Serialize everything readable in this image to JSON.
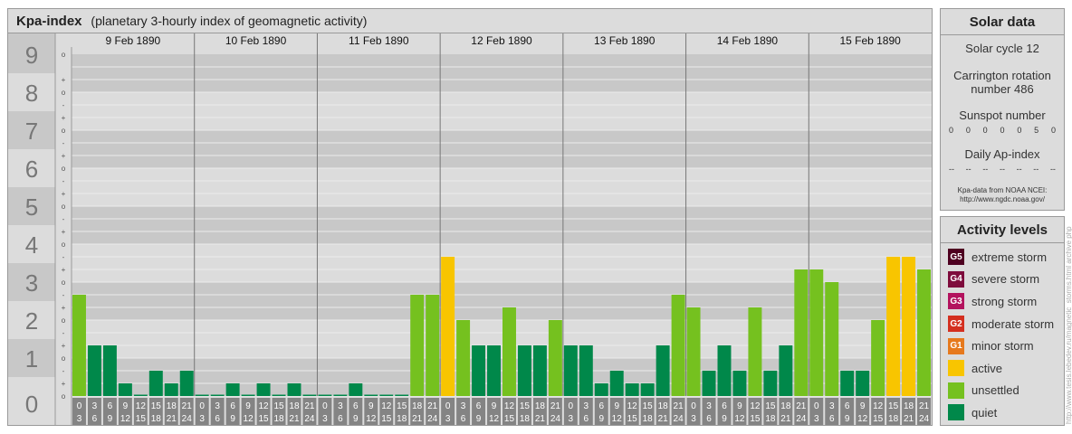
{
  "header": {
    "title": "Kpa-index",
    "subtitle": "(planetary 3-hourly index of geomagnetic activity)"
  },
  "chart_data": {
    "type": "bar",
    "y_range": [
      0,
      9
    ],
    "y_ticks": [
      "0",
      "1",
      "2",
      "3",
      "4",
      "5",
      "6",
      "7",
      "8",
      "9"
    ],
    "y_minor_ticks": [
      "o",
      "+",
      "-"
    ],
    "days": [
      "9 Feb 1890",
      "10 Feb 1890",
      "11 Feb 1890",
      "12 Feb 1890",
      "13 Feb 1890",
      "14 Feb 1890",
      "15 Feb 1890"
    ],
    "intervals": [
      [
        "0",
        "3"
      ],
      [
        "3",
        "6"
      ],
      [
        "6",
        "9"
      ],
      [
        "9",
        "12"
      ],
      [
        "12",
        "15"
      ],
      [
        "15",
        "18"
      ],
      [
        "18",
        "21"
      ],
      [
        "21",
        "24"
      ]
    ],
    "values": [
      2.667,
      1.333,
      1.333,
      0.333,
      0,
      0.667,
      0.333,
      0.667,
      0,
      0,
      0.333,
      0,
      0.333,
      0,
      0.333,
      0,
      0,
      0,
      0.333,
      0,
      0,
      0,
      2.667,
      2.667,
      3.667,
      2.0,
      1.333,
      1.333,
      2.333,
      1.333,
      1.333,
      2.0,
      1.333,
      1.333,
      0.333,
      0.667,
      0.333,
      0.333,
      1.333,
      2.667,
      2.333,
      0.667,
      1.333,
      0.667,
      2.333,
      0.667,
      1.333,
      3.333,
      3.333,
      3.0,
      0.667,
      0.667,
      2.0,
      3.667,
      3.667,
      3.333
    ],
    "colors": {
      "quiet": "#00884a",
      "unsettled": "#75c11f",
      "active": "#f8c500",
      "background_band": "#c8c8c8",
      "axis_cell": "#848484"
    }
  },
  "solar": {
    "title": "Solar data",
    "cycle": "Solar cycle 12",
    "carrington_line1": "Carrington rotation",
    "carrington_line2": "number 486",
    "sunspot_label": "Sunspot number",
    "sunspot_values": [
      "0",
      "0",
      "0",
      "0",
      "0",
      "5",
      "0"
    ],
    "ap_label": "Daily Ap-index",
    "ap_values": [
      "--",
      "--",
      "--",
      "--",
      "--",
      "--",
      "--"
    ],
    "credit_line1": "Kpa-data from NOAA NCEI:",
    "credit_line2": "http://www.ngdc.noaa.gov/"
  },
  "activity": {
    "title": "Activity levels",
    "levels": [
      {
        "badge": "G5",
        "label": "extreme storm",
        "color": "#4e0020"
      },
      {
        "badge": "G4",
        "label": "severe storm",
        "color": "#7e0c3c"
      },
      {
        "badge": "G3",
        "label": "strong storm",
        "color": "#b3135e"
      },
      {
        "badge": "G2",
        "label": "moderate storm",
        "color": "#d42f1f"
      },
      {
        "badge": "G1",
        "label": "minor storm",
        "color": "#e6791d"
      },
      {
        "badge": "",
        "label": "active",
        "color": "#f8c500"
      },
      {
        "badge": "",
        "label": "unsettled",
        "color": "#75c11f"
      },
      {
        "badge": "",
        "label": "quiet",
        "color": "#00884a"
      }
    ]
  },
  "watermark": "http://www.tesis.lebedev.ru/magnetic_storms.html archive php"
}
